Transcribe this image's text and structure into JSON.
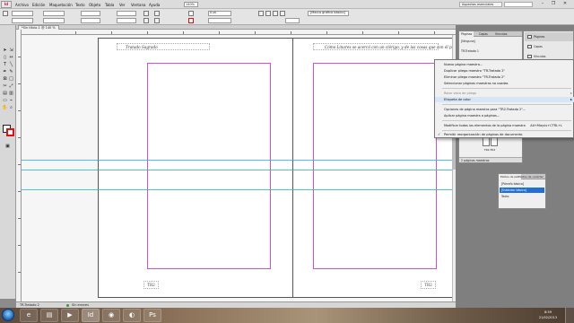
{
  "menubar": {
    "logo": "Id",
    "items": [
      "Archivo",
      "Edición",
      "Maquetación",
      "Texto",
      "Objeto",
      "Tabla",
      "Ver",
      "Ventana",
      "Ayuda"
    ],
    "zoom": "140%",
    "workspace": "Aspectos esenciales",
    "window_controls": [
      "–",
      "❐",
      "✕"
    ]
  },
  "controlbar": {
    "stroke_weight": "0 pt",
    "frame_style": "[Marco gráfico básico]"
  },
  "document": {
    "tab": "*Sin título-1 @ 140 %",
    "left_running_head": "Tratado Sagrado",
    "right_running_head": "Cómo Linares se acercó con un clérigo, y de las cosas que con él pasó.",
    "left_folio": "TR2",
    "right_folio": "TR2"
  },
  "statusbar": {
    "page": "TR-Tratado 2",
    "preflight": "Sin errores"
  },
  "pages_panel": {
    "tabs": [
      "Páginas",
      "Capas",
      "Vínculos"
    ],
    "rows": [
      "[Ninguna]",
      "TR-Tratado 1",
      "TR-Tratado 2"
    ],
    "spread_label": "TR2-TR2",
    "footer": "2 páginas maestras"
  },
  "right_dock": {
    "items": [
      "Páginas",
      "Capas",
      "Vínculos"
    ]
  },
  "context_menu": {
    "items": [
      {
        "label": "Nuevo página maestra...",
        "disabled": false
      },
      {
        "label": "Duplicar pliego maestro \"TR-Tratado 2\"",
        "disabled": false
      },
      {
        "label": "Eliminar pliego maestro \"TR-Tratado 2\"",
        "disabled": false
      },
      {
        "label": "Seleccionar páginas maestras no usadas",
        "disabled": false
      },
      {
        "label": "Rotar vista de pliego",
        "disabled": true,
        "submenu": true
      },
      {
        "label": "Etiqueta de color",
        "disabled": false,
        "submenu": true,
        "highlighted": true
      },
      {
        "label": "Opciones de página maestra para \"TR2-Tratado 2\"...",
        "disabled": false
      },
      {
        "label": "Aplicar página maestra a páginas...",
        "disabled": false
      },
      {
        "label": "Modificar todos los elementos de la página maestra",
        "disabled": false,
        "shortcut": "Alt+Mayús+CTRL+L"
      },
      {
        "label": "Permitir reorganización de páginas de documento",
        "disabled": false,
        "checked": true
      }
    ]
  },
  "styles_panel": {
    "tabs": [
      "Estilos de pár.",
      "Estilos de carácter"
    ],
    "rows": [
      "[Párrafo básico]",
      "[Estándar básico]",
      "Texto"
    ],
    "selected_index": 1
  },
  "taskbar": {
    "apps": [
      "IE",
      "Explorador",
      "Reproductor",
      "InDesign",
      "Chrome",
      "Firefox",
      "Photoshop"
    ],
    "clock_time": "8:59",
    "clock_date": "21/02/2013"
  }
}
